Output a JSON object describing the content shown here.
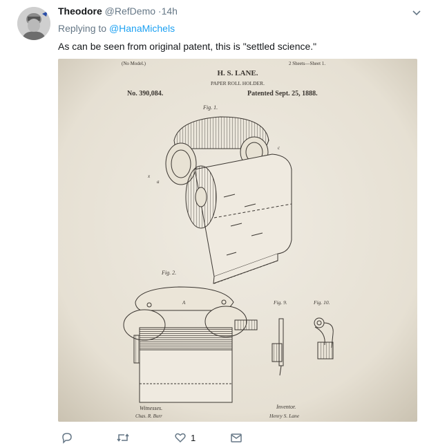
{
  "tweet": {
    "display_name": "Theodore",
    "handle": "@RefDemo",
    "separator": "·",
    "time": "14h",
    "replying_prefix": "Replying to",
    "replying_to": "@HanaMichels",
    "text": "As can be seen from original patent, this is \"settled science.\""
  },
  "patent": {
    "model": "(No Model.)",
    "sheets": "2 Sheets—Sheet 1.",
    "inventor_name": "H. S. LANE.",
    "title": "PAPER ROLL HOLDER.",
    "number": "No. 390,084.",
    "patented": "Patented Sept. 25, 1888.",
    "fig1": "Fig. 1.",
    "fig2": "Fig. 2.",
    "fig9": "Fig. 9.",
    "fig10": "Fig. 10.",
    "witnesses": "Witnesses.",
    "witness_sig": "Chas. R. Burr",
    "inventor_label": "Inventor.",
    "inventor_sig": "Henry S. Lane"
  },
  "actions": {
    "reply_icon": "reply-icon",
    "retweet_icon": "retweet-icon",
    "like_icon": "heart-icon",
    "like_count": "1",
    "message_icon": "envelope-icon"
  },
  "colors": {
    "link": "#1da1f2",
    "muted": "#657786",
    "paper": "#e9e4d8",
    "ink": "#3a3530"
  }
}
